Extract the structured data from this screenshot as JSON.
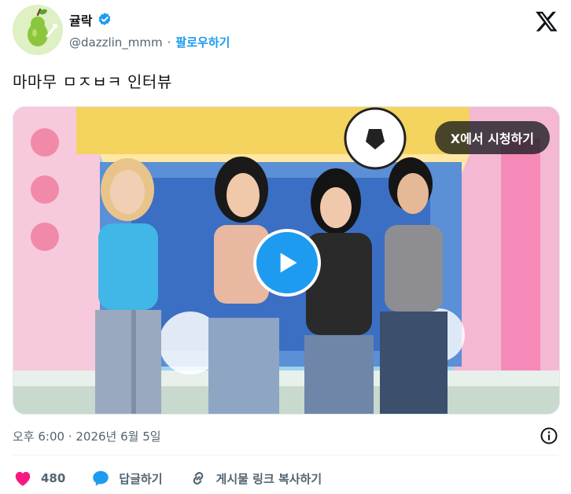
{
  "author": {
    "display_name": "귤락",
    "handle": "@dazzlin_mmm",
    "separator": "·",
    "follow_label": "팔로우하기",
    "verified": true,
    "avatar": "green-pear-avatar"
  },
  "tweet": {
    "text": "마마무 ㅁㅈㅂㅋ 인터뷰"
  },
  "media": {
    "watch_label": "X에서 시청하기",
    "play_icon": "play-icon"
  },
  "meta": {
    "timestamp": "오후 6:00 · 2026년 6월 5일",
    "info_icon": "info-icon"
  },
  "actions": {
    "like_count": "480",
    "reply_label": "답글하기",
    "copy_link_label": "게시물 링크 복사하기"
  },
  "colors": {
    "accent": "#1d9bf0",
    "like": "#f91880",
    "text": "#0f1419",
    "muted": "#536471"
  }
}
